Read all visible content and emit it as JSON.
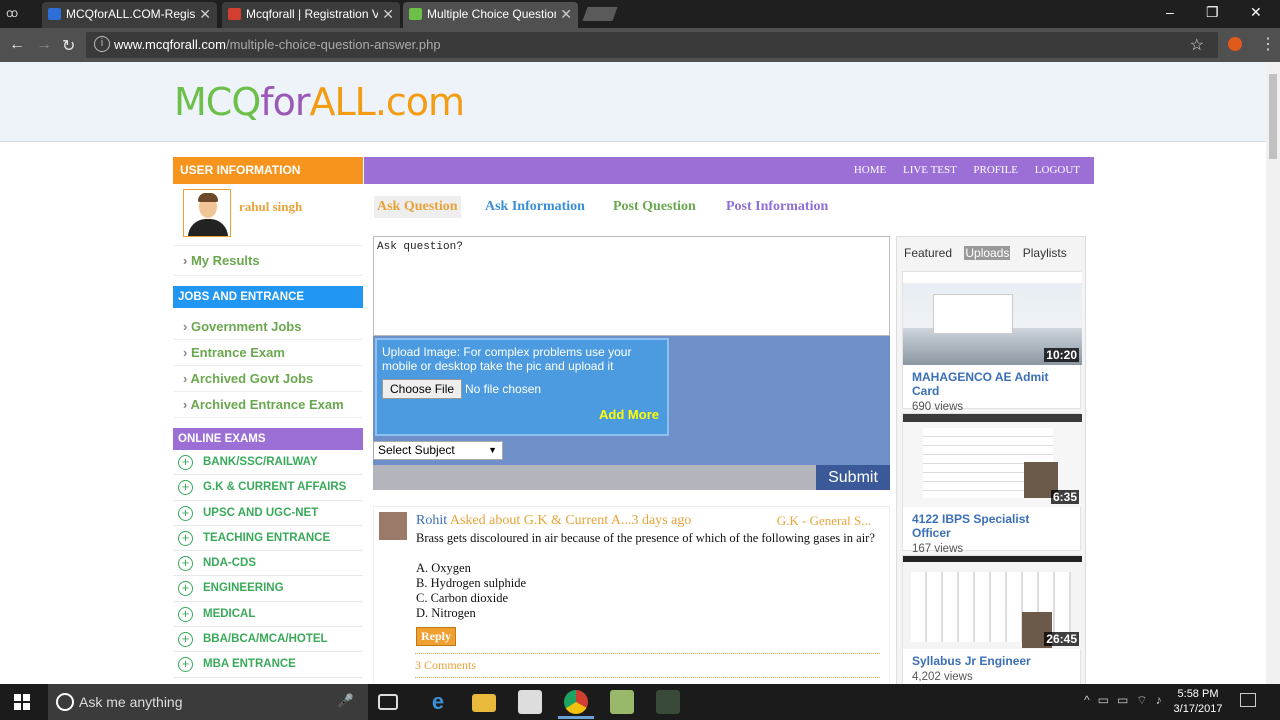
{
  "browser": {
    "tabs": [
      {
        "title": "MCQforALL.COM-Registr",
        "favicon_color": "#2d6fd6"
      },
      {
        "title": "Mcqforall | Registration V",
        "favicon_color": "#d23f31"
      },
      {
        "title": "Multiple Choice Question",
        "favicon_color": "#6cc04a"
      }
    ],
    "url_host": "www.mcqforall.com",
    "url_path": "/multiple-choice-question-answer.php",
    "window_controls": [
      "–",
      "❐",
      "✕"
    ]
  },
  "site": {
    "logo": {
      "part1": "MCQ",
      "part2": "for",
      "part3": "ALL.com"
    },
    "top_nav": [
      "HOME",
      "LIVE TEST",
      "PROFILE",
      "LOGOUT"
    ]
  },
  "sidebar": {
    "user_info": {
      "heading": "USER INFORMATION",
      "username": "rahul singh",
      "links": [
        "My Results"
      ],
      "color": "#f7941d"
    },
    "jobs": {
      "heading": "JOBS AND ENTRANCE",
      "links": [
        "Government Jobs",
        "Entrance Exam",
        "Archived Govt Jobs",
        "Archived Entrance Exam"
      ],
      "color": "#2196f3"
    },
    "online_exams": {
      "heading": "ONLINE EXAMS",
      "items": [
        "BANK/SSC/RAILWAY",
        "G.K & CURRENT AFFAIRS",
        "UPSC AND UGC-NET",
        "TEACHING ENTRANCE",
        "NDA-CDS",
        "ENGINEERING",
        "MEDICAL",
        "BBA/BCA/MCA/HOTEL",
        "MBA ENTRANCE"
      ],
      "color": "#9b6fd6"
    }
  },
  "action_tabs": [
    {
      "label": "Ask Question",
      "color": "#e8a33a",
      "active": true
    },
    {
      "label": "Ask Information",
      "color": "#3b8fd6",
      "active": false
    },
    {
      "label": "Post Question",
      "color": "#6aa84f",
      "active": false
    },
    {
      "label": "Post Information",
      "color": "#8e6fd6",
      "active": false
    }
  ],
  "form": {
    "question_placeholder": "Ask question?",
    "upload_text": "Upload Image: For complex problems use your mobile or desktop take the pic and upload it",
    "choose_file": "Choose File",
    "no_file": "No file chosen",
    "add_more": "Add More",
    "subject_select": "Select Subject",
    "submit": "Submit"
  },
  "post": {
    "author": "Rohit",
    "meta": " Asked about G.K & Current A...3 days ago",
    "category": "G.K - General S...",
    "question": "Brass gets discoloured in air because of the presence of which of the following gases in air?",
    "options": [
      "A. Oxygen",
      "B. Hydrogen sulphide",
      "C. Carbon dioxide",
      "D. Nitrogen"
    ],
    "reply": "Reply",
    "comments": "3 Comments"
  },
  "youtube": {
    "tabs": [
      "Featured",
      "Uploads",
      "Playlists"
    ],
    "active_tab": "Uploads",
    "videos": [
      {
        "title": "MAHAGENCO AE Admit Card",
        "views": "690 views",
        "duration": "10:20"
      },
      {
        "title": "4122 IBPS Specialist Officer",
        "views": "167 views",
        "duration": "6:35"
      },
      {
        "title": "Syllabus Jr Engineer",
        "views": "4,202 views",
        "duration": "26:45"
      }
    ]
  },
  "taskbar": {
    "search_placeholder": "Ask me anything",
    "time": "5:58 PM",
    "date": "3/17/2017"
  }
}
